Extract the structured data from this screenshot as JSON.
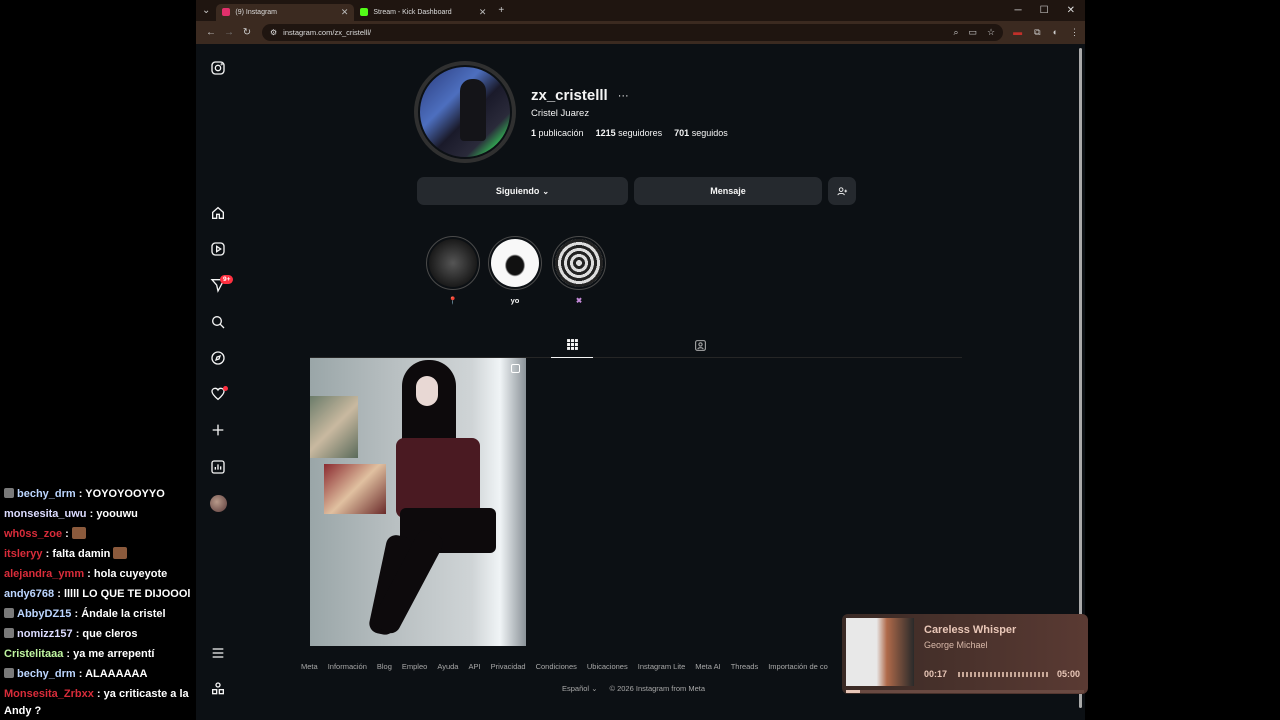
{
  "chat": [
    {
      "user": "bechy_drm",
      "color": "#bcd6ff",
      "badge": true,
      "msg": "YOYOYOOYYO"
    },
    {
      "user": "monsesita_uwu",
      "color": "#dcdcff",
      "badge": false,
      "msg": "yoouwu"
    },
    {
      "user": "wh0ss_zoe",
      "color": "#d92c3a",
      "badge": false,
      "msg": "",
      "emote": true
    },
    {
      "user": "itsleryy",
      "color": "#d92c3a",
      "badge": false,
      "msg": "falta damin",
      "emote": true
    },
    {
      "user": "alejandra_ymm",
      "color": "#d92c3a",
      "badge": false,
      "msg": "hola cuyeyote"
    },
    {
      "user": "andy6768",
      "color": "#bcd6ff",
      "badge": false,
      "msg": "lllll LO QUE TE DIJOOOl"
    },
    {
      "user": "AbbyDZ15",
      "color": "#bcd6ff",
      "badge": true,
      "msg": "Ándale la cristel"
    },
    {
      "user": "nomizz157",
      "color": "#dcdcff",
      "badge": true,
      "msg": "que cleros"
    },
    {
      "user": "Cristelitaaa",
      "color": "#bff5a0",
      "badge": false,
      "msg": "ya me arrepentí"
    },
    {
      "user": "bechy_drm",
      "color": "#bcd6ff",
      "badge": true,
      "msg": "ALAAAAAA"
    },
    {
      "user": "Monsesita_Zrbxx",
      "color": "#d92c3a",
      "badge": false,
      "msg": "ya criticaste a la Andy ?",
      "wrap": true
    }
  ],
  "browser": {
    "tabs": [
      {
        "title": "(9) Instagram",
        "active": true,
        "color": "#e1306c"
      },
      {
        "title": "Stream - Kick Dashboard",
        "active": false,
        "color": "#53fc18"
      }
    ],
    "url": "instagram.com/zx_cristelll/"
  },
  "profile": {
    "username": "zx_cristelll",
    "more": "···",
    "full_name": "Cristel Juarez",
    "posts_count": "1",
    "posts_label": "publicación",
    "followers_count": "1215",
    "followers_label": "seguidores",
    "following_count": "701",
    "following_label": "seguidos",
    "follow_button": "Siguiendo",
    "message_button": "Mensaje"
  },
  "highlights": [
    {
      "label": "📍",
      "color": "#e0306c"
    },
    {
      "label": "yo",
      "color": "#f5f5f5"
    },
    {
      "label": "✖",
      "color": "#c48ad8"
    }
  ],
  "nav": {
    "notif_count": "9+"
  },
  "footer": {
    "links": [
      "Meta",
      "Información",
      "Blog",
      "Empleo",
      "Ayuda",
      "API",
      "Privacidad",
      "Condiciones",
      "Ubicaciones",
      "Instagram Lite",
      "Meta AI",
      "Threads",
      "Importación de co"
    ],
    "language": "Español",
    "copyright": "© 2026 Instagram from Meta"
  },
  "music": {
    "title": "Careless Whisper",
    "artist": "George Michael",
    "elapsed": "00:17",
    "total": "05:00",
    "progress": 0.057
  }
}
